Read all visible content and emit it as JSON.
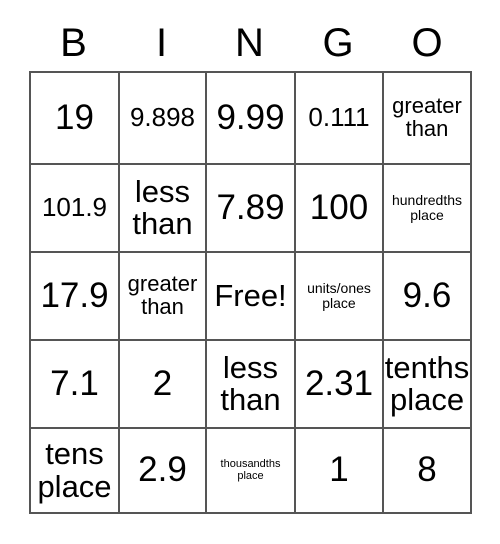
{
  "card": {
    "type": "bingo-card",
    "columns": 5,
    "rows": 5,
    "header": {
      "letters": [
        "B",
        "I",
        "N",
        "G",
        "O"
      ]
    },
    "grid": [
      [
        {
          "text": "19",
          "size": "fs-xl"
        },
        {
          "text": "9.898",
          "size": "fs-md"
        },
        {
          "text": "9.99",
          "size": "fs-xl"
        },
        {
          "text": "0.111",
          "size": "fs-md"
        },
        {
          "text": "greater\nthan",
          "size": "fs-sm"
        }
      ],
      [
        {
          "text": "101.9",
          "size": "fs-md"
        },
        {
          "text": "less\nthan",
          "size": "fs-lg"
        },
        {
          "text": "7.89",
          "size": "fs-xl"
        },
        {
          "text": "100",
          "size": "fs-xl"
        },
        {
          "text": "hundredths\nplace",
          "size": "fs-xs"
        }
      ],
      [
        {
          "text": "17.9",
          "size": "fs-xl"
        },
        {
          "text": "greater\nthan",
          "size": "fs-sm"
        },
        {
          "text": "Free!",
          "size": "fs-lg"
        },
        {
          "text": "units/ones\nplace",
          "size": "fs-xs"
        },
        {
          "text": "9.6",
          "size": "fs-xl"
        }
      ],
      [
        {
          "text": "7.1",
          "size": "fs-xl"
        },
        {
          "text": "2",
          "size": "fs-xl"
        },
        {
          "text": "less\nthan",
          "size": "fs-lg"
        },
        {
          "text": "2.31",
          "size": "fs-xl"
        },
        {
          "text": "tenths\nplace",
          "size": "fs-lg"
        }
      ],
      [
        {
          "text": "tens\nplace",
          "size": "fs-lg"
        },
        {
          "text": "2.9",
          "size": "fs-xl"
        },
        {
          "text": "thousandths\nplace",
          "size": "fs-xxs"
        },
        {
          "text": "1",
          "size": "fs-xl"
        },
        {
          "text": "8",
          "size": "fs-xl"
        }
      ]
    ],
    "free_space": {
      "row": 2,
      "column": 2,
      "label": "Free!"
    },
    "colors": {
      "background": "#ffffff",
      "text": "#000000",
      "grid_line": "#555555"
    }
  }
}
